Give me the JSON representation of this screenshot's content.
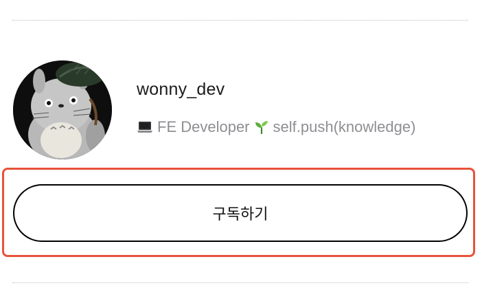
{
  "profile": {
    "username": "wonny_dev",
    "bio_icon_1": "laptop-icon",
    "bio_part_1": "FE Developer",
    "bio_icon_2": "sprout-icon",
    "bio_part_2": "self.push(knowledge)"
  },
  "subscribe": {
    "label": "구독하기"
  },
  "colors": {
    "highlight_border": "#e8523a",
    "bio_text": "#8e8e93",
    "username_text": "#1b1b1b",
    "button_border": "#000000"
  }
}
